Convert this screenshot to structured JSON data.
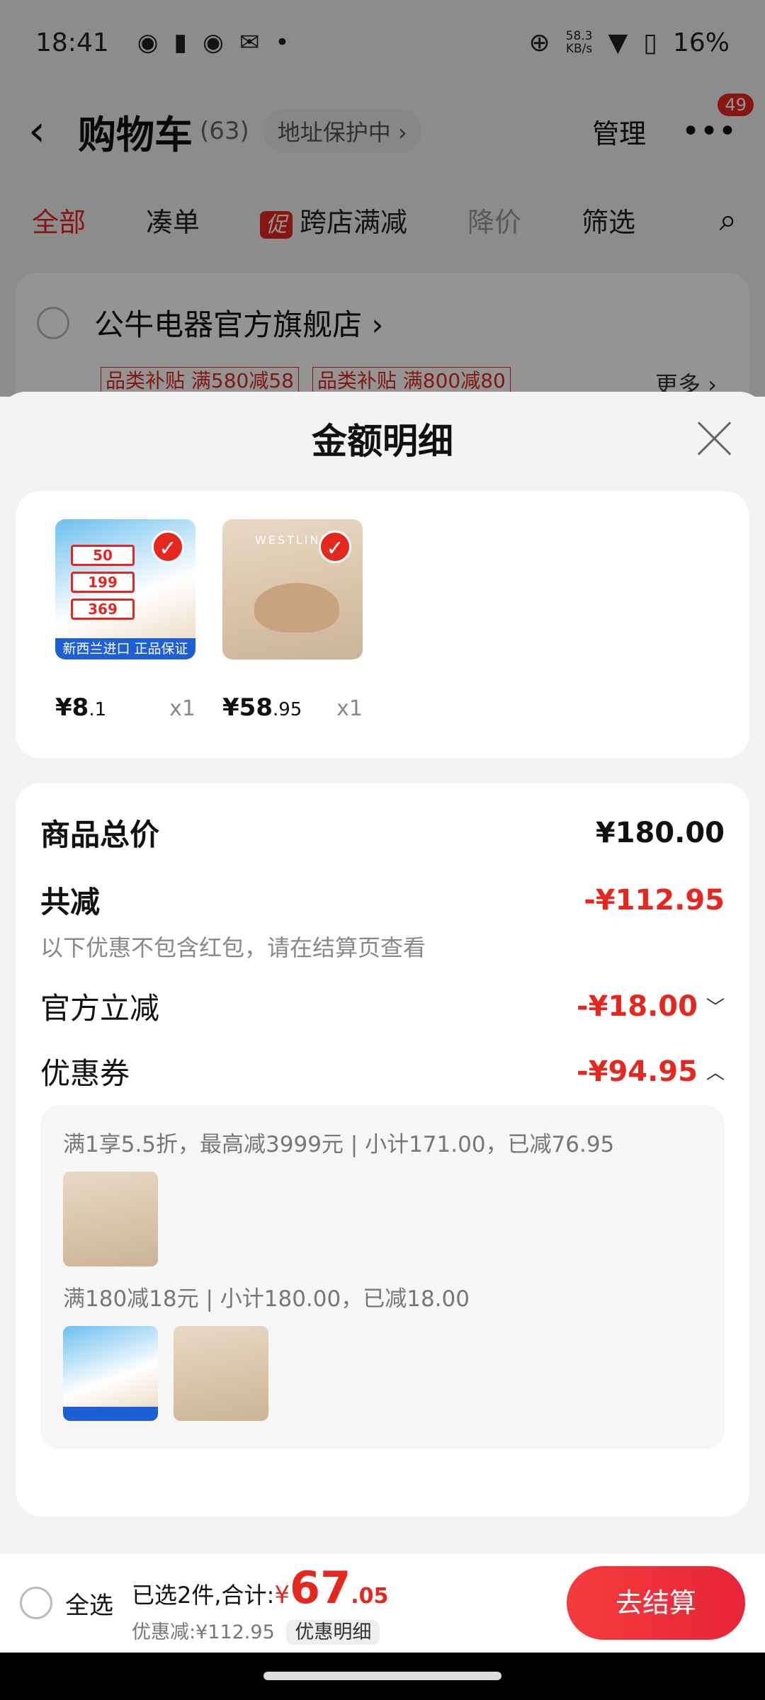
{
  "status": {
    "time": "18:41",
    "left_icons": [
      "wechat-icon",
      "alert-icon",
      "wechat-icon",
      "mail-icon",
      "dot-icon"
    ],
    "speed": "58.3",
    "speed_unit": "KB/s",
    "battery": "16%"
  },
  "nav": {
    "back": "‹",
    "title": "购物车",
    "count": "(63)",
    "address": "地址保护中 ›",
    "manage": "管理",
    "more": "•••",
    "badge": "49"
  },
  "tabs": [
    {
      "label": "全部"
    },
    {
      "label": "凑单"
    },
    {
      "label": "跨店满减",
      "tag": "促"
    },
    {
      "label": "降价"
    },
    {
      "label": "筛选"
    }
  ],
  "store": {
    "name": "公牛电器官方旗舰店 ›",
    "tag1": "品类补贴 满580减58",
    "tag2": "品类补贴 满800减80",
    "more": "更多 ›"
  },
  "sheet": {
    "title": "金额明细",
    "products": [
      {
        "price_main": "¥8",
        "price_dec": ".1",
        "qty": "x1",
        "band": "新西兰进口 正品保证",
        "tags": [
          "50",
          "199",
          "369"
        ]
      },
      {
        "price_main": "¥58",
        "price_dec": ".95",
        "qty": "x1",
        "brand": "WESTLINK"
      }
    ],
    "total_label": "商品总价",
    "total_value": "¥180.00",
    "reduce_label": "共减",
    "reduce_value": "-¥112.95",
    "reduce_note": "以下优惠不包含红包，请在结算页查看",
    "official_label": "官方立减",
    "official_value": "-¥18.00",
    "coupon_label": "优惠券",
    "coupon_value": "-¥94.95",
    "coupon_line1": "满1享5.5折，最高减3999元 | 小计171.00，已减76.95",
    "coupon_line2": "满180减18元 | 小计180.00，已减18.00"
  },
  "checkout": {
    "select_all": "全选",
    "selected": "已选2件,合计:",
    "currency": "¥",
    "total_int": "67",
    "total_dec": ".05",
    "discount": "优惠减:¥112.95",
    "detail": "优惠明细",
    "pay": "去结算"
  },
  "colors": {
    "accent": "#e5281f"
  }
}
